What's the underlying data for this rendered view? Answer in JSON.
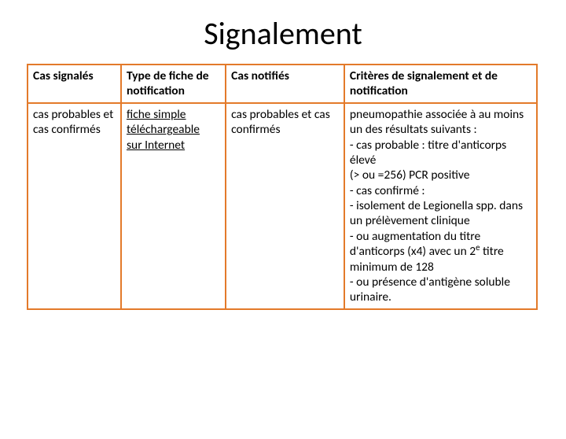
{
  "title": "Signalement",
  "table": {
    "header": {
      "col1": "Cas signalés",
      "col2": "Type de fiche de notification",
      "col3": "Cas notifiés",
      "col4": "Critères de signalement et de notification"
    },
    "row": {
      "col1": "cas probables et cas confirmés",
      "col2_link1": "fiche simple",
      "col2_linebreak_link2a": "téléchargeable",
      "col2_link2b": "sur Internet",
      "col3": "cas probables et cas confirmés",
      "col4_l1": "pneumopathie associée à au moins un des résultats suivants :",
      "col4_l2": "- cas probable : titre d'anticorps élevé",
      "col4_l3": "(> ou =256) PCR positive",
      "col4_l4": "- cas confirmé :",
      "col4_l5": "- isolement de Legionella spp. dans un prélèvement clinique",
      "col4_l6a": "- ou augmentation du titre d'anticorps (x4) avec un 2",
      "col4_l6_sup": "e",
      "col4_l6b": " titre minimum de 128",
      "col4_l7": "- ou présence d'antigène soluble urinaire."
    }
  }
}
